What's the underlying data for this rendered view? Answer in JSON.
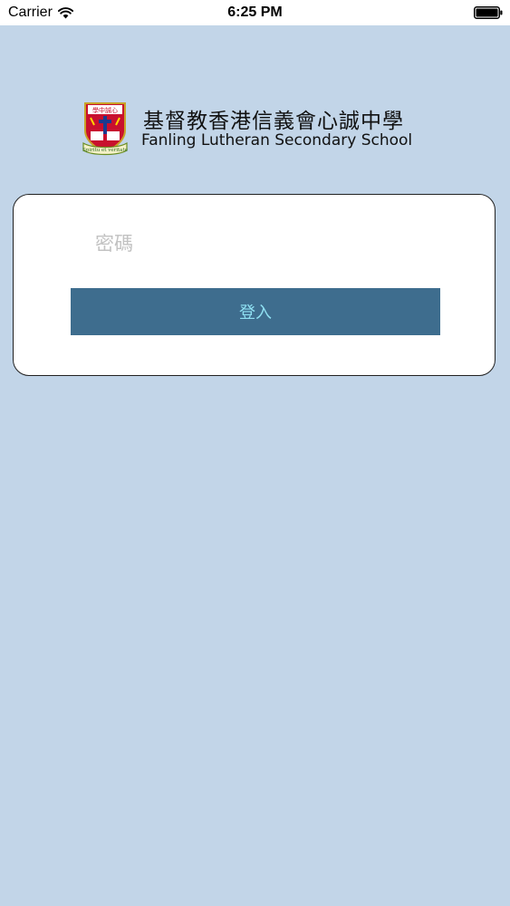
{
  "status_bar": {
    "carrier": "Carrier",
    "time": "6:25 PM",
    "wifi_icon": "wifi-icon",
    "battery_icon": "battery-full-icon"
  },
  "header": {
    "school_name_zh": "基督教香港信義會心誠中學",
    "school_name_en": "Fanling Lutheran Secondary School",
    "logo_icon": "school-crest-logo",
    "logo_motto": "Spiritu et veritate"
  },
  "login": {
    "password_placeholder": "密碼",
    "login_button_label": "登入"
  },
  "colors": {
    "background": "#c2d5e8",
    "button_bg": "#3e6d8e",
    "button_text": "#8fe0f2",
    "card_bg": "#ffffff"
  }
}
